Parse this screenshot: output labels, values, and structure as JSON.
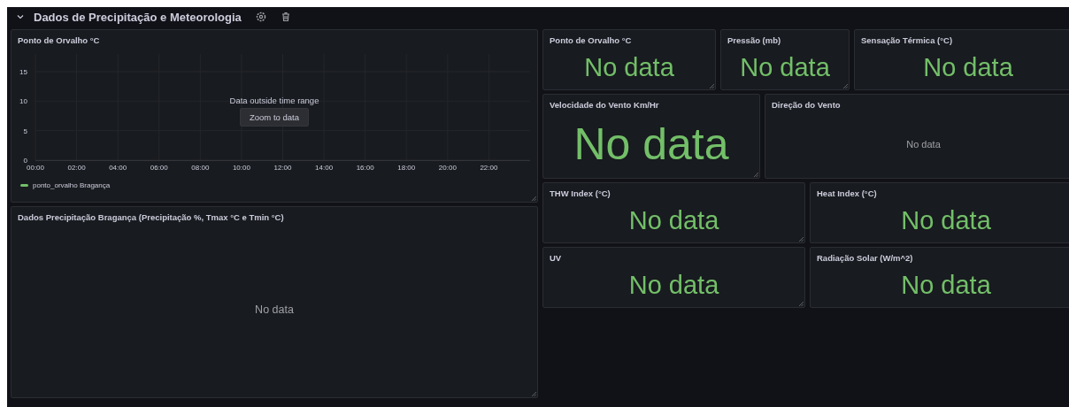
{
  "row_header": {
    "title": "Dados de Precipitação e Meteorologia",
    "expanded": true
  },
  "left_panels": [
    {
      "kind": "timeseries",
      "title": "Ponto de Orvalho °C",
      "message": "Data outside time range",
      "action": "Zoom to data",
      "chart_data": {
        "type": "line",
        "ylim": [
          0,
          18
        ],
        "grid": true,
        "categories": [
          "00:00",
          "02:00",
          "04:00",
          "06:00",
          "08:00",
          "10:00",
          "12:00",
          "14:00",
          "16:00",
          "18:00",
          "20:00",
          "22:00"
        ],
        "yticks": [
          0,
          5,
          10,
          15
        ],
        "series": [
          {
            "name": "ponto_orvalho Bragança",
            "color": "#73bf69",
            "values": [
              null,
              null,
              null,
              null,
              null,
              null,
              null,
              null,
              null,
              null,
              null,
              null
            ]
          }
        ]
      }
    },
    {
      "kind": "empty",
      "title": "Dados Precipitação Bragança (Precipitação %, Tmax °C e Tmin °C)",
      "message": "No data"
    }
  ],
  "right_rows": [
    [
      {
        "kind": "stat",
        "title": "Ponto de Orvalho °C",
        "value": "No data"
      },
      {
        "kind": "stat",
        "title": "Pressão (mb)",
        "value": "No data"
      },
      {
        "kind": "stat",
        "title": "Sensação Térmica (°C)",
        "value": "No data"
      }
    ],
    [
      {
        "kind": "stat",
        "title": "Velocidade do Vento Km/Hr",
        "value": "No data"
      },
      {
        "kind": "empty",
        "title": "Direção do Vento",
        "message": "No data"
      }
    ],
    [
      {
        "kind": "stat",
        "title": "THW Index (°C)",
        "value": "No data"
      },
      {
        "kind": "stat",
        "title": "Heat Index (°C)",
        "value": "No data"
      }
    ],
    [
      {
        "kind": "stat",
        "title": "UV",
        "value": "No data"
      },
      {
        "kind": "stat",
        "title": "Radiação Solar (W/m^2)",
        "value": "No data"
      }
    ]
  ]
}
